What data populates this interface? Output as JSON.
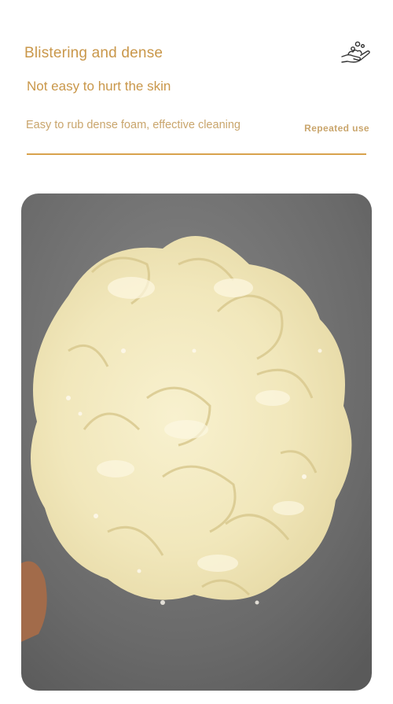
{
  "heading": {
    "title": "Blistering and dense",
    "subtitle": "Not easy to hurt the skin",
    "description": "Easy to rub dense foam, effective cleaning",
    "right_label": "Repeated use"
  },
  "icons": {
    "hand_bubbles": "hand-with-bubbles-icon"
  },
  "colors": {
    "accent": "#c9974a",
    "divider": "#d8a24c",
    "photo_background": "#6b6b6b",
    "sponge": "#f3ebc4"
  }
}
